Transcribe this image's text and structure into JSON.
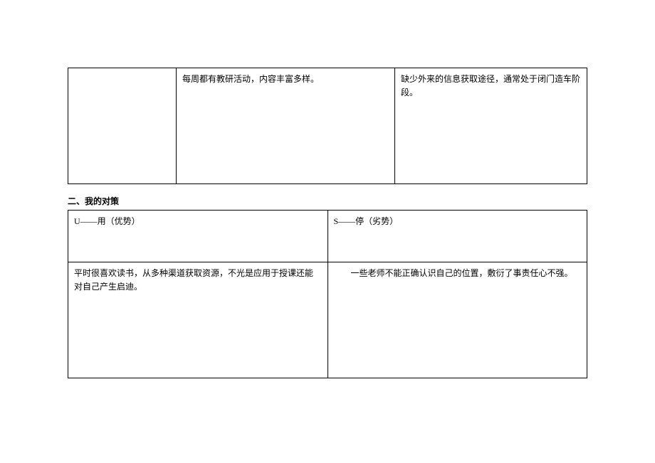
{
  "table1": {
    "row1": {
      "col1": "",
      "col2": "每周都有教研活动，内容丰富多样。",
      "col3": "缺少外来的信息获取途径，通常处于闭门造车阶段。"
    }
  },
  "section2": {
    "title": "二、我的对策",
    "headers": {
      "left": "U——用（优势）",
      "right": "S——停（劣势）"
    },
    "content": {
      "left": "平时很喜欢读书，从多种渠道获取资源，不光是应用于授课还能对自己产生启迪。",
      "right": "一些老师不能正确认识自己的位置，敷衍了事责任心不强。"
    }
  }
}
